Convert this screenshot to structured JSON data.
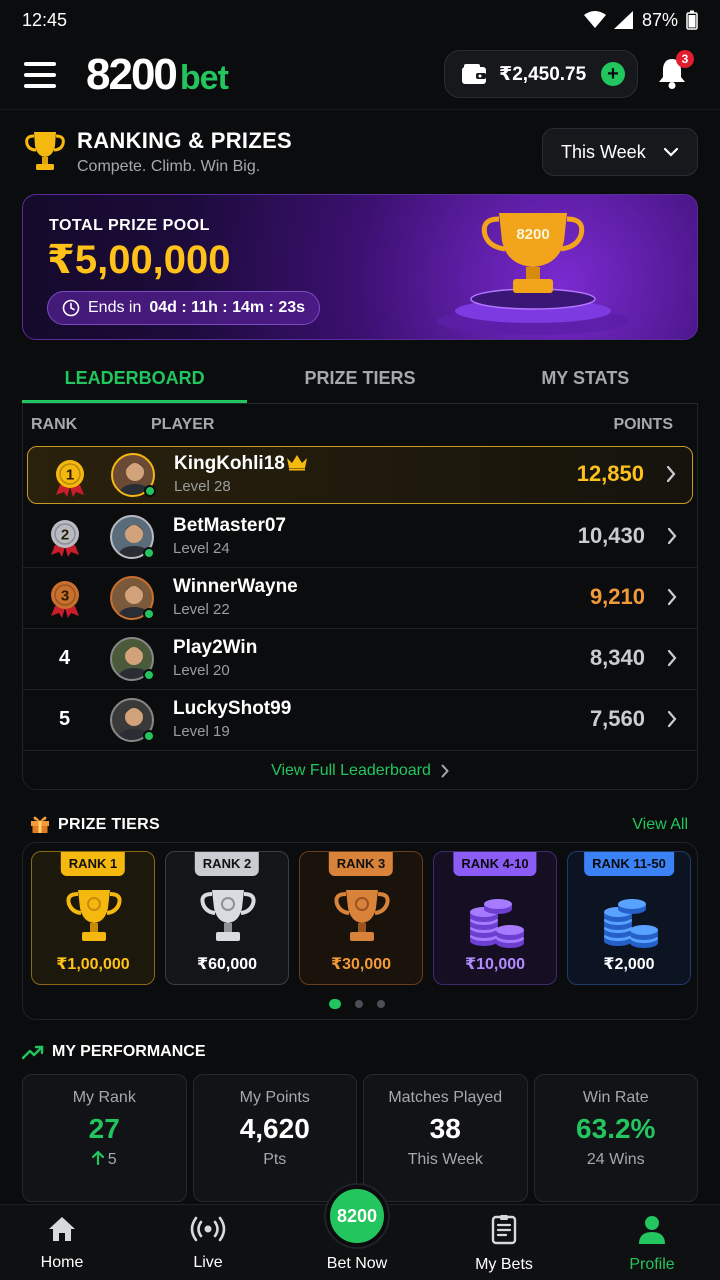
{
  "status": {
    "time": "12:45",
    "battery": "87%"
  },
  "header": {
    "logo_main": "8200",
    "logo_sub": "bet",
    "wallet_amount": "₹2,450.75",
    "notification_count": "3"
  },
  "ranking": {
    "title": "RANKING & PRIZES",
    "subtitle": "Compete. Climb. Win Big.",
    "period": "This Week"
  },
  "prize_pool": {
    "label": "TOTAL PRIZE POOL",
    "amount": "₹5,00,000",
    "ends_prefix": "Ends in",
    "ends_value": "04d : 11h : 14m : 23s",
    "trophy_text": "8200"
  },
  "tabs": [
    {
      "label": "LEADERBOARD",
      "active": true
    },
    {
      "label": "PRIZE TIERS",
      "active": false
    },
    {
      "label": "MY STATS",
      "active": false
    }
  ],
  "leaderboard": {
    "columns": {
      "rank": "RANK",
      "player": "PLAYER",
      "points": "POINTS"
    },
    "rows": [
      {
        "rank": "1",
        "name": "KingKohli18",
        "level": "Level 28",
        "points": "12,850",
        "points_color": "#ffc21a",
        "medal": "#f5b80f"
      },
      {
        "rank": "2",
        "name": "BetMaster07",
        "level": "Level 24",
        "points": "10,430",
        "points_color": "#c9ccd0",
        "medal": "#b8bcc2"
      },
      {
        "rank": "3",
        "name": "WinnerWayne",
        "level": "Level 22",
        "points": "9,210",
        "points_color": "#f29a3a",
        "medal": "#c9702e"
      },
      {
        "rank": "4",
        "name": "Play2Win",
        "level": "Level 20",
        "points": "8,340",
        "points_color": "#c9ccd0"
      },
      {
        "rank": "5",
        "name": "LuckyShot99",
        "level": "Level 19",
        "points": "7,560",
        "points_color": "#c9ccd0"
      }
    ],
    "view_full": "View Full Leaderboard"
  },
  "prize_tiers": {
    "title": "PRIZE TIERS",
    "view_all": "View All",
    "tiers": [
      {
        "label": "RANK 1",
        "amount": "₹1,00,000",
        "label_bg": "#f5b80f",
        "amount_color": "#ffc21a",
        "border": "#8a6a14",
        "bg": "#1c180c",
        "art": "gold-trophy"
      },
      {
        "label": "RANK 2",
        "amount": "₹60,000",
        "label_bg": "#c9ccd0",
        "amount_color": "#ffffff",
        "border": "#3a3d42",
        "bg": "#141518",
        "art": "silver-trophy"
      },
      {
        "label": "RANK 3",
        "amount": "₹30,000",
        "label_bg": "#d8823a",
        "amount_color": "#f29a3a",
        "border": "#6a3e1a",
        "bg": "#1a130c",
        "art": "bronze-trophy"
      },
      {
        "label": "RANK 4-10",
        "amount": "₹10,000",
        "label_bg": "#8b5cf6",
        "amount_color": "#b28cff",
        "border": "#3f2a6e",
        "bg": "#160f24",
        "art": "purple-coins"
      },
      {
        "label": "RANK 11-50",
        "amount": "₹2,000",
        "label_bg": "#3b82f6",
        "amount_color": "#ffffff",
        "border": "#1f3a6e",
        "bg": "#0c1424",
        "art": "blue-coins"
      }
    ]
  },
  "performance": {
    "title": "MY PERFORMANCE",
    "stats": [
      {
        "label": "My Rank",
        "value": "27",
        "sub": "5",
        "value_color": "#22c55e",
        "sub_arrow": true
      },
      {
        "label": "My Points",
        "value": "4,620",
        "sub": "Pts",
        "value_color": "#ffffff"
      },
      {
        "label": "Matches Played",
        "value": "38",
        "sub": "This Week",
        "value_color": "#ffffff"
      },
      {
        "label": "Win Rate",
        "value": "63.2%",
        "sub": "24 Wins",
        "value_color": "#22c55e"
      }
    ]
  },
  "bottom_nav": {
    "home": "Home",
    "live": "Live",
    "bet_now": "Bet Now",
    "bet_now_badge": "8200",
    "my_bets": "My Bets",
    "profile": "Profile"
  }
}
